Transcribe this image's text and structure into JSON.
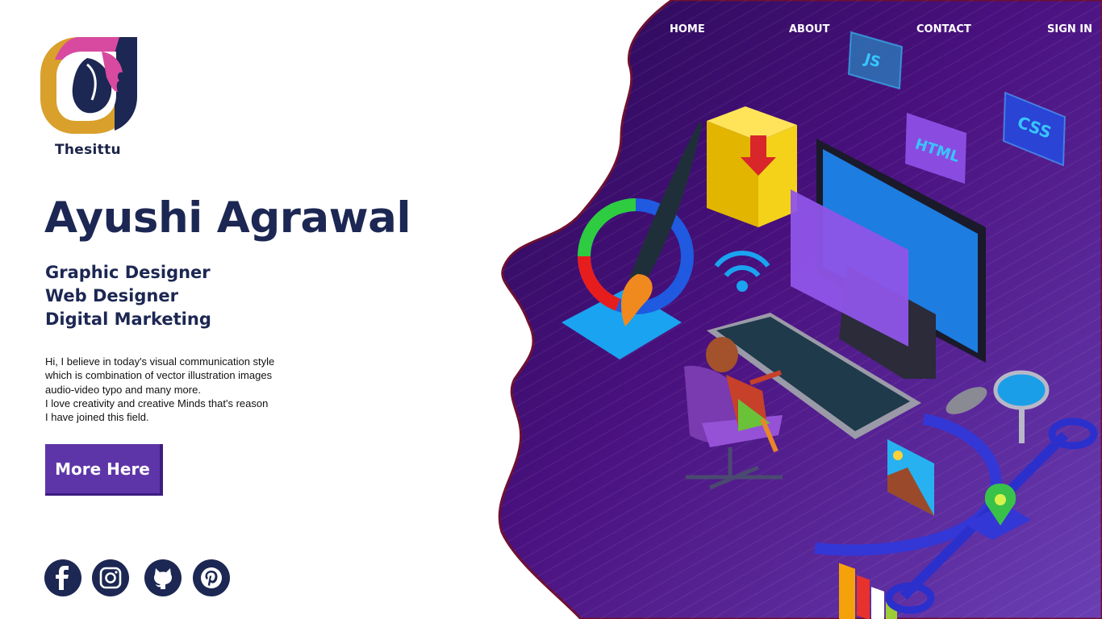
{
  "brand": {
    "name": "Thesittu",
    "logo_icon": "leaf-face-icon"
  },
  "nav": {
    "items": [
      {
        "label": "HOME"
      },
      {
        "label": "ABOUT"
      },
      {
        "label": "CONTACT"
      },
      {
        "label": "SIGN IN"
      }
    ]
  },
  "hero": {
    "name": "Ayushi Agrawal",
    "roles": [
      "Graphic Designer",
      "Web Designer",
      "Digital Marketing"
    ],
    "bio_lines": [
      "Hi,  I  believe in today's visual communication style",
      "which is combination of vector illustration images",
      "audio-video typo and many more.",
      "I love creativity and creative Minds that's reason",
      "I have joined this field."
    ],
    "cta_label": "More Here"
  },
  "social": [
    {
      "icon": "facebook-icon"
    },
    {
      "icon": "instagram-icon"
    },
    {
      "icon": "github-icon"
    },
    {
      "icon": "pinterest-icon"
    }
  ],
  "illustration": {
    "tags": [
      "JS",
      "HTML",
      "CSS"
    ]
  },
  "colors": {
    "primary_text": "#1c2753",
    "accent_purple": "#5e35a8",
    "blob_dark": "#2a0b5c",
    "blob_light": "#6a2bb0"
  }
}
